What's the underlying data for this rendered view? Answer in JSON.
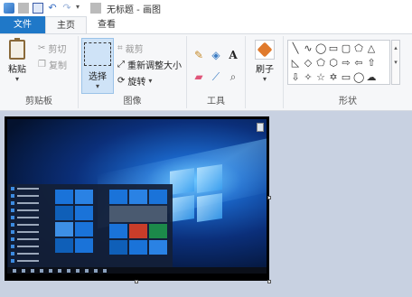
{
  "window": {
    "title": "无标题 - 画图"
  },
  "tabs": {
    "file": "文件",
    "home": "主页",
    "view": "查看"
  },
  "clipboard": {
    "paste": "粘贴",
    "cut": "剪切",
    "copy": "复制",
    "group_label": "剪贴板"
  },
  "image": {
    "select": "选择",
    "crop": "裁剪",
    "resize": "重新调整大小",
    "rotate": "旋转",
    "group_label": "图像"
  },
  "tools": {
    "group_label": "工具",
    "text_glyph": "A"
  },
  "brushes": {
    "label": "刷子"
  },
  "shapes": {
    "group_label": "形状"
  },
  "colors": {
    "file_tab": "#1f78c8",
    "canvas_bg": "#c8d1e1",
    "select_active": "#cfe3f7"
  }
}
